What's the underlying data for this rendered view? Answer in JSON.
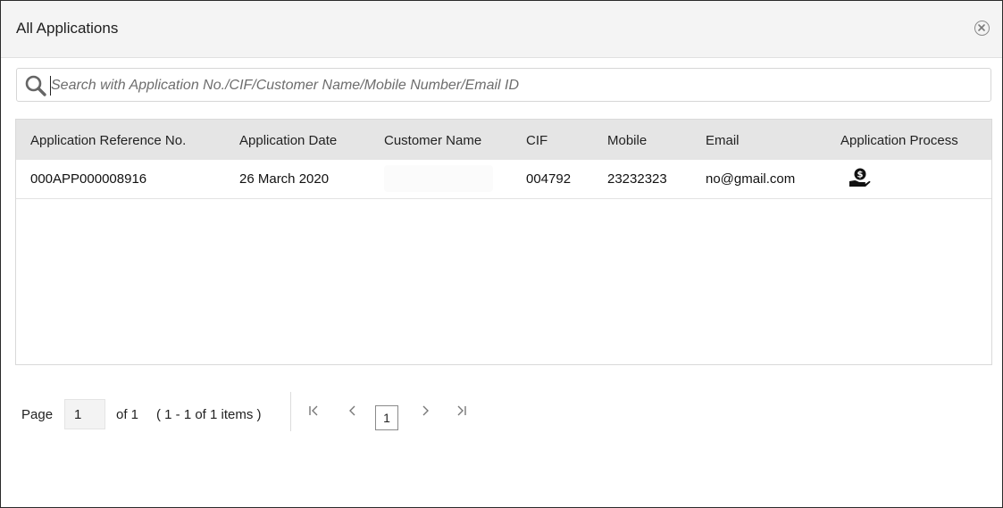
{
  "dialog": {
    "title": "All Applications",
    "close_icon": "close-circle-icon"
  },
  "search": {
    "placeholder": "Search with Application No./CIF/Customer Name/Mobile Number/Email ID",
    "value": "",
    "icon": "search-icon"
  },
  "table": {
    "columns": [
      "Application Reference No.",
      "Application Date",
      "Customer Name",
      "CIF",
      "Mobile",
      "Email",
      "Application Process"
    ],
    "rows": [
      {
        "reference_no": "000APP000008916",
        "date": "26 March 2020",
        "customer_name": "",
        "cif": "004792",
        "mobile": "23232323",
        "email": "no@gmail.com",
        "process_icon": "hand-money-icon"
      }
    ]
  },
  "pager": {
    "page_label": "Page",
    "current_page": "1",
    "of_label": "of 1",
    "items_summary": "( 1 - 1 of 1 items )",
    "first_icon": "first-page-icon",
    "prev_icon": "prev-page-icon",
    "page_button": "1",
    "next_icon": "next-page-icon",
    "last_icon": "last-page-icon"
  }
}
